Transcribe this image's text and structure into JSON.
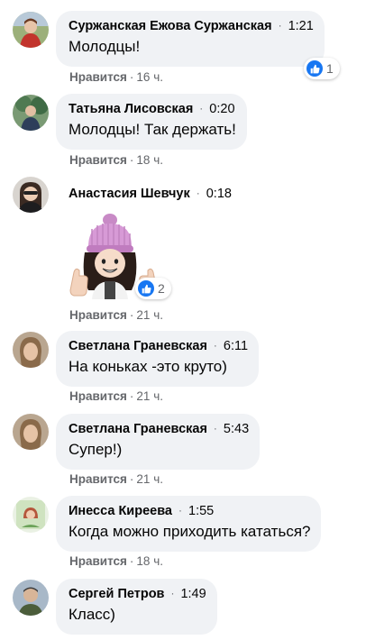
{
  "comments": [
    {
      "author": "Суржанская Ежова Суржанская",
      "time": "1:21",
      "text": "Молодцы!",
      "like_label": "Нравится",
      "age": "16 ч.",
      "reaction_count": "1"
    },
    {
      "author": "Татьяна Лисовская",
      "time": "0:20",
      "text": "Молодцы! Так держать!",
      "like_label": "Нравится",
      "age": "18 ч."
    },
    {
      "author": "Анастасия Шевчук",
      "time": "0:18",
      "like_label": "Нравится",
      "age": "21 ч.",
      "reaction_count": "2"
    },
    {
      "author": "Светлана Граневская",
      "time": "6:11",
      "text": "На коньках -это круто)",
      "like_label": "Нравится",
      "age": "21 ч."
    },
    {
      "author": "Светлана Граневская",
      "time": "5:43",
      "text": "Супер!)",
      "like_label": "Нравится",
      "age": "21 ч."
    },
    {
      "author": "Инесса Киреева",
      "time": "1:55",
      "text": "Когда можно приходить кататься?",
      "like_label": "Нравится",
      "age": "18 ч."
    },
    {
      "author": "Сергей Петров",
      "time": "1:49",
      "text": "Класс)"
    }
  ],
  "separator": "·",
  "icons": {
    "reaction": "like-icon",
    "sticker": "girl-thumbs-up-sticker"
  },
  "colors": {
    "bubble": "#f0f2f5",
    "like_blue": "#1877f2",
    "secondary_text": "#65676b"
  }
}
